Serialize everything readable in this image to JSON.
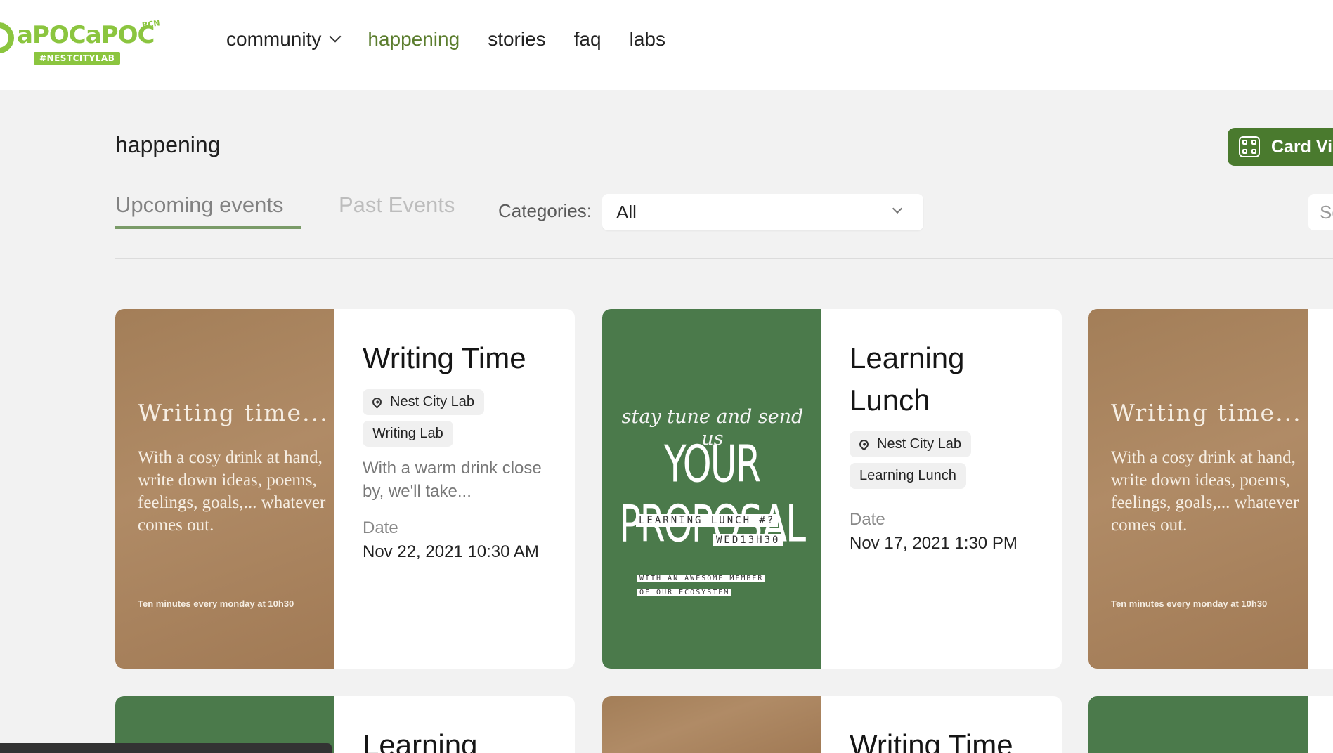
{
  "header": {
    "logo_text": "aPOCaPOC",
    "logo_superscript": "BCN",
    "logo_badge": "#NESTCITYLAB",
    "nav": [
      {
        "label": "community",
        "has_dropdown": true,
        "active": false
      },
      {
        "label": "happening",
        "active": true
      },
      {
        "label": "stories",
        "active": false
      },
      {
        "label": "faq",
        "active": false
      },
      {
        "label": "labs",
        "active": false
      }
    ]
  },
  "page": {
    "title": "happening",
    "view_toggle_label": "Card Vie",
    "tabs": [
      {
        "label": "Upcoming events",
        "active": true
      },
      {
        "label": "Past Events",
        "active": false
      }
    ],
    "categories_label": "Categories:",
    "categories_value": "All",
    "search_placeholder": "Se"
  },
  "posters": {
    "writing": {
      "heading": "Writing time...",
      "body": "With a cosy drink at hand, write down ideas, poems, feelings, goals,... whatever comes out.",
      "footer": "Ten minutes every monday at 10h30"
    },
    "proposal": {
      "script": "stay tune and send us",
      "big": "YOUR PROPOSAL",
      "tag1": "LEARNING LUNCH #?",
      "tag2": "WED13H30",
      "tag3": "WITH AN AWESOME MEMBER",
      "tag4": "OF OUR ECOSYSTEM"
    }
  },
  "cards": [
    {
      "title": "Writing Time",
      "location": "Nest City Lab",
      "category": "Writing Lab",
      "description": "With a warm drink close by, we'll take...",
      "date_label": "Date",
      "date": "Nov 22, 2021 10:30 AM",
      "image": "writing"
    },
    {
      "title": "Learning Lunch",
      "location": "Nest City Lab",
      "category": "Learning Lunch",
      "date_label": "Date",
      "date": "Nov 17, 2021 1:30 PM",
      "image": "proposal"
    },
    {
      "image": "writing"
    },
    {
      "title": "Learning",
      "image": "green"
    },
    {
      "title": "Writing Time",
      "image": "brown"
    },
    {
      "image": "green"
    }
  ],
  "colors": {
    "brand_green": "#8bc53f",
    "active_nav": "#5b7d2e",
    "button_green": "#4a7a2e",
    "poster_brown": "#a37e58",
    "poster_green": "#4b7a4b"
  }
}
